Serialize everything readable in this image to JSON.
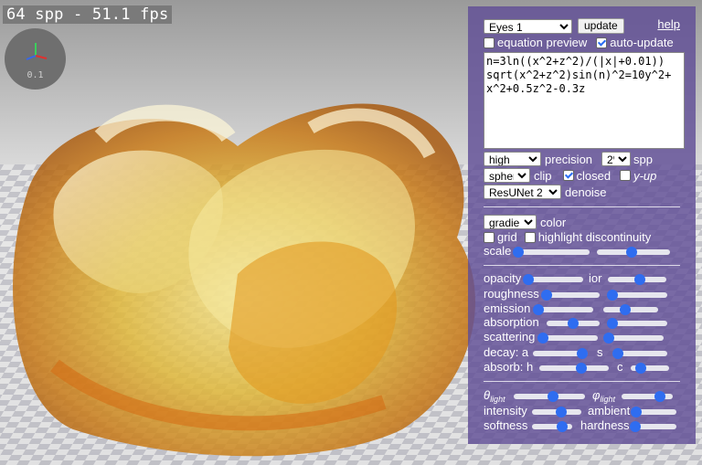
{
  "overlay": {
    "stats": "64 spp - 51.1 fps",
    "axes_scale": "0.1"
  },
  "panel": {
    "preset": "Eyes 1",
    "update_label": "update",
    "help_label": "help",
    "equation_preview_label": "equation preview",
    "equation_preview_checked": false,
    "auto_update_label": "auto-update",
    "auto_update_checked": true,
    "equation": "n=3ln((x^2+z^2)/(|x|+0.01))\nsqrt(x^2+z^2)sin(n)^2=10y^2+\nx^2+0.5z^2-0.3z",
    "precision_value": "high",
    "precision_label": "precision",
    "spp_value": "2⁰",
    "spp_label": "spp",
    "clip_value": "sphere",
    "clip_label": "clip",
    "closed_label": "closed",
    "closed_checked": true,
    "yup_label": "y-up",
    "yup_checked": false,
    "denoise_value": "ResUNet 2",
    "denoise_label": "denoise",
    "color_value": "gradient",
    "color_label": "color",
    "grid_label": "grid",
    "grid_checked": false,
    "highlight_label": "highlight discontinuity",
    "highlight_checked": false,
    "sliders": {
      "scale_label": "scale",
      "opacity_label": "opacity",
      "ior_label": "ior",
      "roughness_label": "roughness",
      "emission_label": "emission",
      "absorption_label": "absorption",
      "scattering_label": "scattering",
      "decay_a_label": "decay: a",
      "decay_s_label": "s",
      "absorb_h_label": "absorb: h",
      "absorb_c_label": "c",
      "theta_label": "θ",
      "theta_sub": "light",
      "phi_label": "φ",
      "phi_sub": "light",
      "intensity_label": "intensity",
      "ambient_label": "ambient",
      "softness_label": "softness",
      "hardness_label": "hardness"
    },
    "levels": {
      "scale_a": 0.0,
      "scale_b": 0.48,
      "opacity": 0.0,
      "ior": 0.55,
      "roughness": 0.0,
      "roughness_b": 0.0,
      "emission": 0.0,
      "emission_b": 0.4,
      "absorption": 0.5,
      "absorption_b": 0.0,
      "scattering": 0.0,
      "scattering_b": 0.0,
      "decay_a": 0.9,
      "decay_s": 0.1,
      "absorb_h": 0.6,
      "absorb_c": 0.25,
      "theta": 0.55,
      "phi": 0.75,
      "intensity": 0.6,
      "ambient": 0.0,
      "softness": 0.75,
      "hardness": 0.0
    },
    "accent": "#2f6df0",
    "panel_color": "#604e96"
  }
}
